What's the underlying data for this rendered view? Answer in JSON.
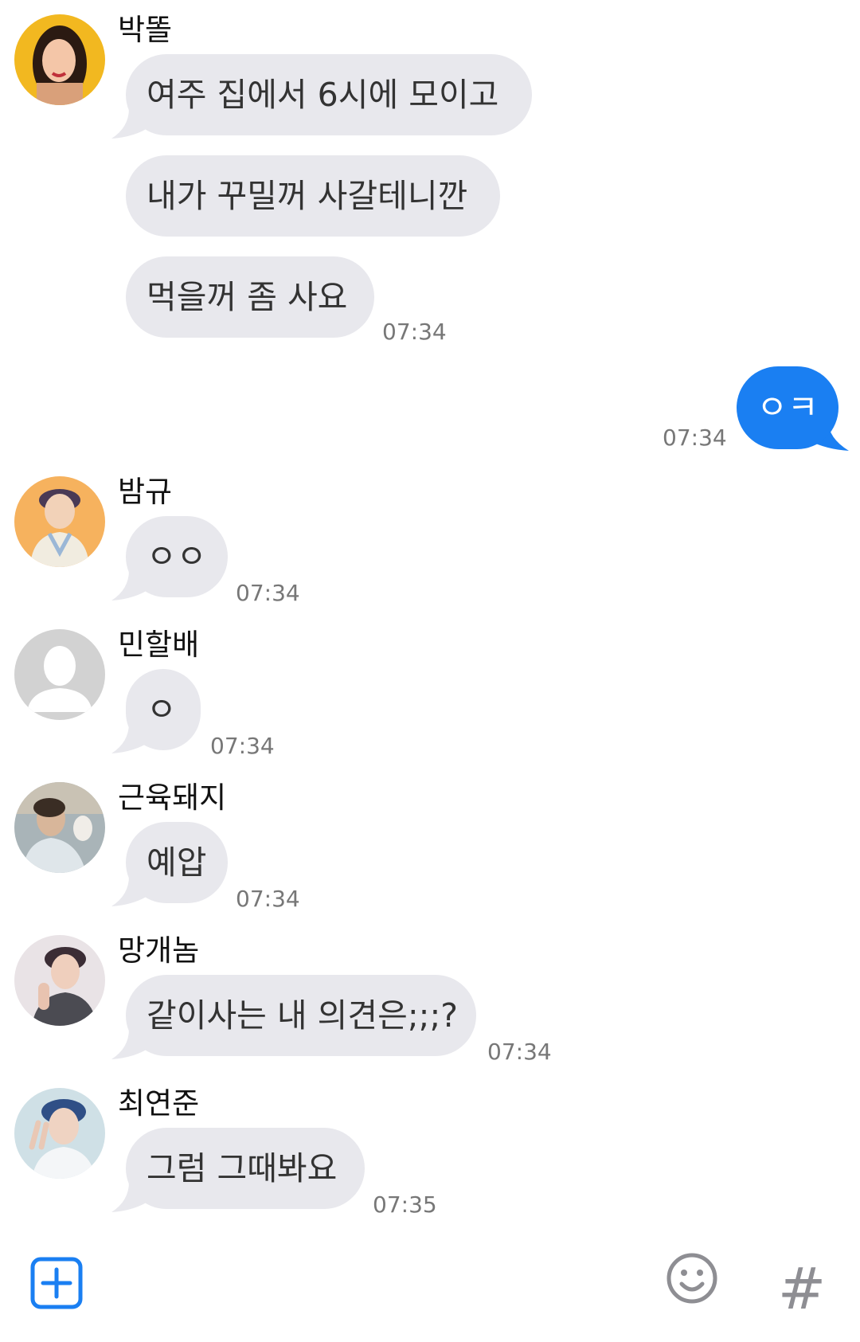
{
  "messages": [
    {
      "sender": "박똘",
      "lines": [
        "여주 집에서 6시에 모이고",
        "내가 꾸밀꺼 사갈테니깐",
        "먹을꺼 좀 사요"
      ],
      "time": "07:34"
    },
    {
      "outgoing": true,
      "text": "ㅇㅋ",
      "time": "07:34"
    },
    {
      "sender": "밤규",
      "lines": [
        "ㅇㅇ"
      ],
      "time": "07:34"
    },
    {
      "sender": "민할배",
      "lines": [
        "ㅇ"
      ],
      "time": "07:34"
    },
    {
      "sender": "근육돼지",
      "lines": [
        "예압"
      ],
      "time": "07:34"
    },
    {
      "sender": "망개놈",
      "lines": [
        "같이사는 내 의견은;;;?"
      ],
      "time": "07:34"
    },
    {
      "sender": "최연준",
      "lines": [
        "그럼 그때봐요"
      ],
      "time": "07:35"
    }
  ],
  "bottom_bar": {
    "add_icon": "plus-square-icon",
    "emoji_icon": "smiley-icon",
    "hashtag_icon": "hashtag-icon",
    "hashtag_glyph": "#"
  },
  "colors": {
    "incoming_bubble": "#e8e8ed",
    "outgoing_bubble": "#1a7ff2",
    "accent": "#1a7ff2"
  }
}
